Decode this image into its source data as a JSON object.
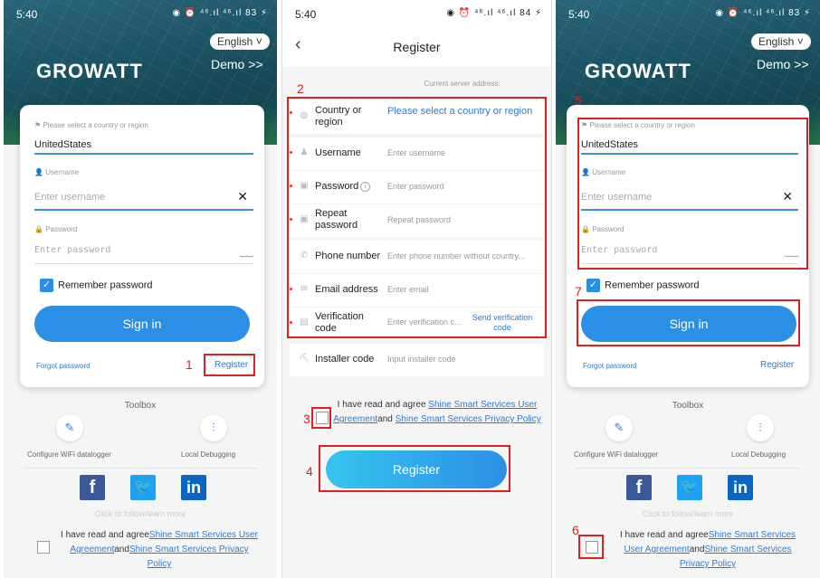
{
  "status_bar": {
    "panel1_time": "5:40",
    "panel2_time": "5:40",
    "panel3_time": "5:40",
    "panel1_icons": "◉ ⏰ ⁴⁶.ıl ⁴⁶.ıl 83 ⚡",
    "panel2_icons": "◉ ⏰ ⁴⁶.ıl ⁴⁶.ıl 84 ⚡",
    "panel3_icons": "◉ ⏰ ⁴⁶.ıl ⁴⁶.ıl 83 ⚡"
  },
  "login": {
    "language": "English ˅",
    "demo": "Demo >>",
    "logo": "GROWATT",
    "country_caption": "Please select a country or region",
    "country_value": "UnitedStates",
    "username_caption": "Username",
    "username_placeholder": "Enter username",
    "password_caption": "Password",
    "password_placeholder": "Enter password",
    "remember_label": "Remember password",
    "signin_label": "Sign in",
    "forgot_label": "Forgot password",
    "register_label": "Register",
    "toolbox_label": "Toolbox",
    "wifi_label": "Configure WiFi datalogger",
    "debug_label": "Local Debugging",
    "follow_label": "Click to follow/learn more",
    "agree_prefix": "I have read and agree",
    "agree_link1": "Shine Smart Services User Agreement",
    "agree_and": "and",
    "agree_link2": "Shine Smart Services Privacy Policy",
    "clear_icon": "✕"
  },
  "register": {
    "title": "Register",
    "server_label": "Current server address:",
    "rows": [
      {
        "label": "Country or region",
        "placeholder": "Please select a country or region"
      },
      {
        "label": "Username",
        "placeholder": "Enter username"
      },
      {
        "label": "Password",
        "placeholder": "Enter password"
      },
      {
        "label": "Repeat password",
        "placeholder": "Repeat password"
      },
      {
        "label": "Phone number",
        "placeholder": "Enter phone number without country..."
      },
      {
        "label": "Email address",
        "placeholder": "Enter email"
      },
      {
        "label": "Verification code",
        "placeholder": "Enter verification c...",
        "action": "Send verification code"
      },
      {
        "label": "Installer code",
        "placeholder": "Input installer code"
      }
    ],
    "agree_prefix": "I have read and agree",
    "agree_link1": "Shine Smart Services User Agreement",
    "agree_and": "and",
    "agree_link2": "Shine Smart Services Privacy Policy",
    "button_label": "Register"
  },
  "annotations": {
    "n1": "1",
    "n2": "2",
    "n3": "3",
    "n4": "4",
    "n5": "5",
    "n6": "6",
    "n7": "7"
  },
  "colors": {
    "accent": "#2c8fe6",
    "link": "#2c7bd0",
    "annotation": "#e02020"
  }
}
